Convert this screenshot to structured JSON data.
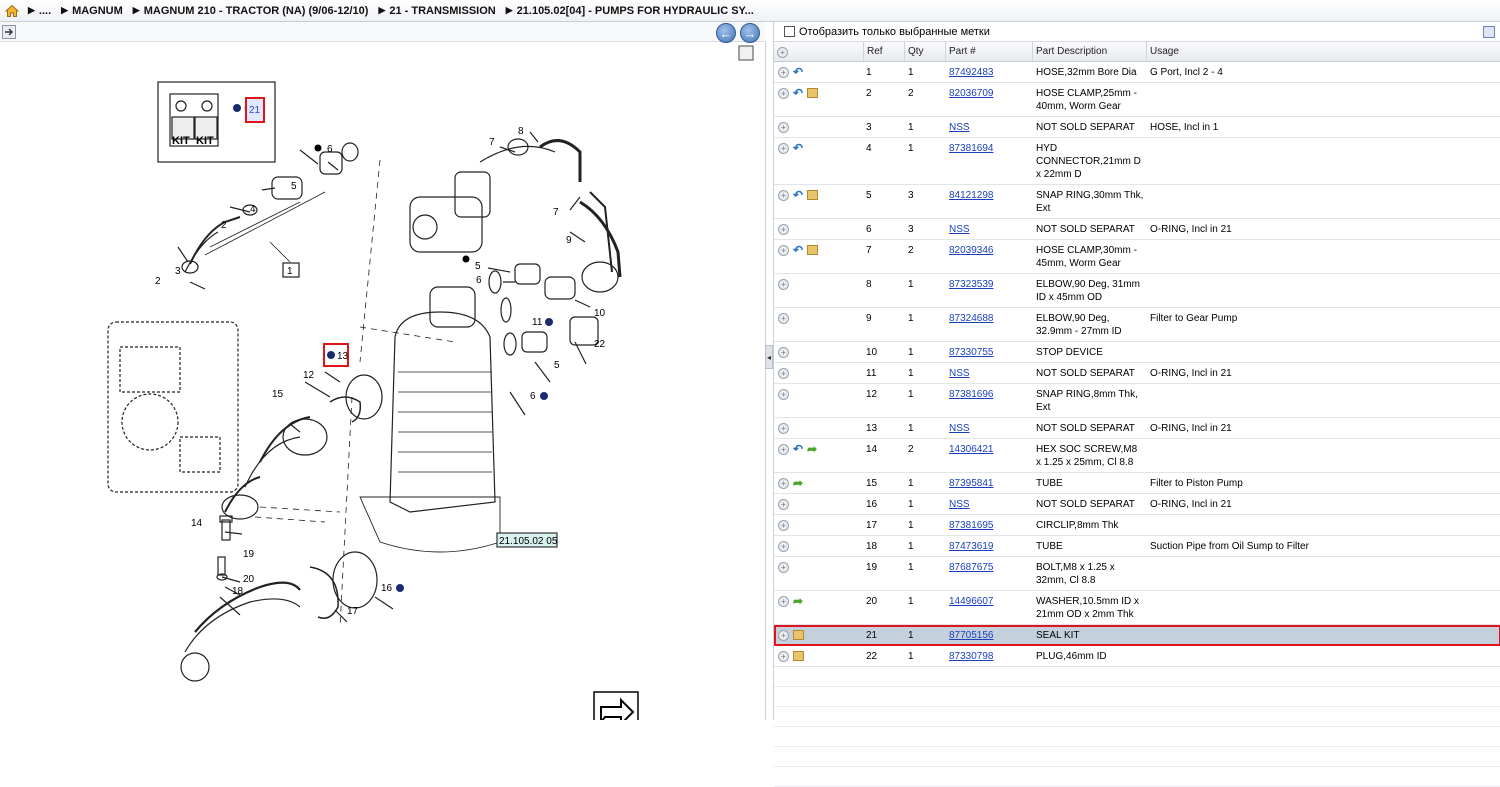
{
  "breadcrumb": {
    "items": [
      "....",
      "MAGNUM",
      "MAGNUM 210 - TRACTOR (NA) (9/06-12/10)",
      "21 - TRANSMISSION",
      "21.105.02[04] - PUMPS FOR HYDRAULIC SY..."
    ]
  },
  "left_panel": {
    "nav_prev": "←",
    "nav_next": "→",
    "diagram": {
      "kit_text_1": "KIT",
      "kit_text_2": "KIT",
      "kit_ref": "21",
      "ref_label": "21.105.02 05",
      "callouts": [
        "1",
        "2",
        "2",
        "3",
        "4",
        "5",
        "6",
        "7",
        "8",
        "7",
        "9",
        "5",
        "6",
        "10",
        "11",
        "22",
        "5",
        "6",
        "13",
        "12",
        "15",
        "14",
        "19",
        "20",
        "18",
        "16",
        "17"
      ]
    }
  },
  "right_panel": {
    "filter_label": "Отобразить только выбранные метки",
    "columns": [
      "",
      "Ref",
      "Qty",
      "Part #",
      "Part Description",
      "Usage"
    ],
    "rows": [
      {
        "icons": [
          "undo"
        ],
        "ref": "1",
        "qty": "1",
        "part": "87492483",
        "desc": "HOSE,32mm Bore Dia",
        "usage": "G Port, Incl 2 - 4"
      },
      {
        "icons": [
          "undo",
          "box"
        ],
        "ref": "2",
        "qty": "2",
        "part": "82036709",
        "desc": "HOSE CLAMP,25mm - 40mm, Worm Gear",
        "usage": ""
      },
      {
        "icons": [],
        "ref": "3",
        "qty": "1",
        "part": "NSS",
        "desc": "NOT SOLD SEPARAT",
        "usage": "HOSE, Incl in 1"
      },
      {
        "icons": [
          "undo"
        ],
        "ref": "4",
        "qty": "1",
        "part": "87381694",
        "desc": "HYD CONNECTOR,21mm D x 22mm D",
        "usage": ""
      },
      {
        "icons": [
          "undo",
          "box"
        ],
        "ref": "5",
        "qty": "3",
        "part": "84121298",
        "desc": "SNAP RING,30mm Thk, Ext",
        "usage": ""
      },
      {
        "icons": [],
        "ref": "6",
        "qty": "3",
        "part": "NSS",
        "desc": "NOT SOLD SEPARAT",
        "usage": "O-RING, Incl in 21"
      },
      {
        "icons": [
          "undo",
          "box"
        ],
        "ref": "7",
        "qty": "2",
        "part": "82039346",
        "desc": "HOSE CLAMP,30mm - 45mm, Worm Gear",
        "usage": ""
      },
      {
        "icons": [],
        "ref": "8",
        "qty": "1",
        "part": "87323539",
        "desc": "ELBOW,90 Deg, 31mm ID x 45mm OD",
        "usage": ""
      },
      {
        "icons": [],
        "ref": "9",
        "qty": "1",
        "part": "87324688",
        "desc": "ELBOW,90 Deg, 32.9mm - 27mm ID",
        "usage": "Filter to Gear Pump"
      },
      {
        "icons": [],
        "ref": "10",
        "qty": "1",
        "part": "87330755",
        "desc": "STOP DEVICE",
        "usage": ""
      },
      {
        "icons": [],
        "ref": "11",
        "qty": "1",
        "part": "NSS",
        "desc": "NOT SOLD SEPARAT",
        "usage": "O-RING,  Incl in 21"
      },
      {
        "icons": [],
        "ref": "12",
        "qty": "1",
        "part": "87381696",
        "desc": "SNAP RING,8mm Thk, Ext",
        "usage": ""
      },
      {
        "icons": [],
        "ref": "13",
        "qty": "1",
        "part": "NSS",
        "desc": "NOT SOLD SEPARAT",
        "usage": "O-RING, Incl in 21"
      },
      {
        "icons": [
          "undo",
          "fwd"
        ],
        "ref": "14",
        "qty": "2",
        "part": "14306421",
        "desc": "HEX SOC SCREW,M8 x 1.25 x 25mm, Cl 8.8",
        "usage": ""
      },
      {
        "icons": [
          "fwd"
        ],
        "ref": "15",
        "qty": "1",
        "part": "87395841",
        "desc": "TUBE",
        "usage": "Filter to Piston Pump"
      },
      {
        "icons": [],
        "ref": "16",
        "qty": "1",
        "part": "NSS",
        "desc": "NOT SOLD SEPARAT",
        "usage": "O-RING, Incl in 21"
      },
      {
        "icons": [],
        "ref": "17",
        "qty": "1",
        "part": "87381695",
        "desc": "CIRCLIP,8mm Thk",
        "usage": ""
      },
      {
        "icons": [],
        "ref": "18",
        "qty": "1",
        "part": "87473619",
        "desc": "TUBE",
        "usage": "Suction Pipe from Oil Sump to Filter"
      },
      {
        "icons": [],
        "ref": "19",
        "qty": "1",
        "part": "87687675",
        "desc": "BOLT,M8 x 1.25 x 32mm, Cl 8.8",
        "usage": ""
      },
      {
        "icons": [
          "fwd"
        ],
        "ref": "20",
        "qty": "1",
        "part": "14496607",
        "desc": "WASHER,10.5mm ID x 21mm OD x 2mm Thk",
        "usage": ""
      },
      {
        "icons": [
          "box"
        ],
        "ref": "21",
        "qty": "1",
        "part": "87705156",
        "desc": "SEAL KIT",
        "usage": "",
        "selected": true
      },
      {
        "icons": [
          "box"
        ],
        "ref": "22",
        "qty": "1",
        "part": "87330798",
        "desc": "PLUG,46mm ID",
        "usage": ""
      }
    ]
  }
}
